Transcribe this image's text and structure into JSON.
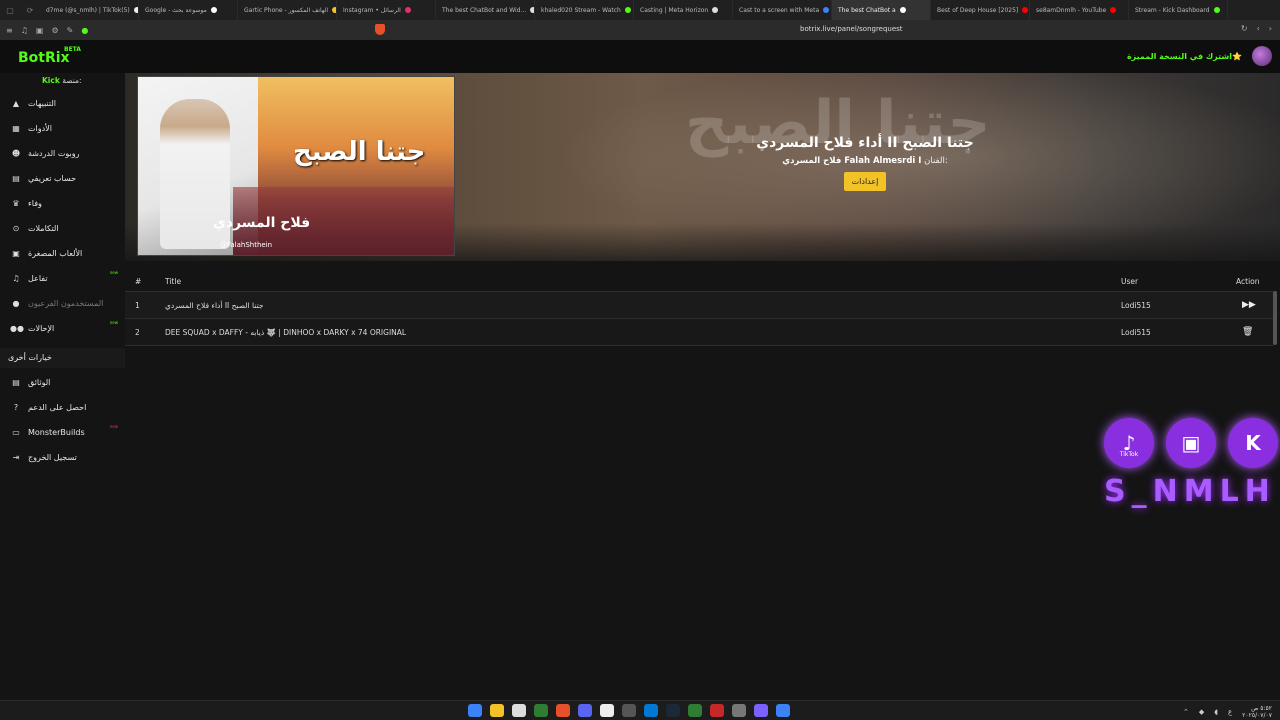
{
  "browser": {
    "tabs": [
      {
        "label": "d7me (@s_nmlh) | TikTok(5)",
        "color": "#eeeeee"
      },
      {
        "label": "Google - موسوعة بحث",
        "color": "#ffffff"
      },
      {
        "label": "Gartic Phone - الهاتف المكسور",
        "color": "#f2c226"
      },
      {
        "label": "Instagram • الرسائل",
        "color": "#e1306c"
      },
      {
        "label": "The best ChatBot and Wid...",
        "color": "#dddddd"
      },
      {
        "label": "khaled020 Stream - Watch",
        "color": "#53fc18"
      },
      {
        "label": "Casting | Meta Horizon",
        "color": "#dddddd"
      },
      {
        "label": "Cast to a screen with Meta",
        "color": "#3b82f6"
      },
      {
        "label": "The best ChatBot a",
        "color": "#ffffff",
        "active": true
      },
      {
        "label": "Best of Deep House [2025]",
        "color": "#ff0000"
      },
      {
        "label": "se8amDnmlh - YouTube",
        "color": "#ff0000"
      },
      {
        "label": "Stream - Kick Dashboard",
        "color": "#53fc18"
      }
    ],
    "url": "botrix.live/panel/songrequest"
  },
  "header": {
    "logo": "BotRix",
    "beta": "BETA",
    "premium_cta": "اشترك في النسخة المميزة⭐"
  },
  "sidebar": {
    "platform_label": "منصة:",
    "platform_value": "Kick",
    "items": [
      {
        "label": "التنبيهات",
        "icon": "warning-icon",
        "glyph": "▲"
      },
      {
        "label": "الأدوات",
        "icon": "grid-icon",
        "glyph": "▦"
      },
      {
        "label": "روبوت الدردشة",
        "icon": "robot-icon",
        "glyph": "☻"
      },
      {
        "label": "حساب تعريفي",
        "icon": "id-card-icon",
        "glyph": "▤"
      },
      {
        "label": "وفاء",
        "icon": "trophy-icon",
        "glyph": "♛"
      },
      {
        "label": "التكاملات",
        "icon": "link-icon",
        "glyph": "⊙"
      },
      {
        "label": "الألعاب المصغرة",
        "icon": "gamepad-icon",
        "glyph": "▣"
      },
      {
        "label": "تفاعل",
        "icon": "music-icon",
        "glyph": "♫",
        "tag": "new"
      },
      {
        "label": "المستخدمون الفرعيون",
        "icon": "users-icon",
        "glyph": "●",
        "dim": true
      },
      {
        "label": "الإحالات",
        "icon": "group-icon",
        "glyph": "●●",
        "tag": "new"
      }
    ],
    "section_title": "خيارات أخرى",
    "other_items": [
      {
        "label": "الوثائق",
        "icon": "docs-icon",
        "glyph": "▤"
      },
      {
        "label": "احصل على الدعم",
        "icon": "help-icon",
        "glyph": "?"
      },
      {
        "label": "MonsterBuilds",
        "icon": "monitor-icon",
        "glyph": "▭",
        "tag": "new"
      },
      {
        "label": "تسجيل الخروج",
        "icon": "logout-icon",
        "glyph": "⇥"
      }
    ]
  },
  "now_playing": {
    "title": "أداء فلاح المسردي II جتنا الصبح",
    "artist_label": "الفنان:",
    "artist": "فلاح المسردي Falah Almesrdi I",
    "settings_label": "إعدادات",
    "cover_title": "جتنا الصبح",
    "cover_handle": "@FalahShthein",
    "cover_sign": "فلاح المسردي"
  },
  "queue": {
    "columns": {
      "num": "#",
      "title": "Title",
      "user": "User",
      "action": "Action"
    },
    "rows": [
      {
        "num": "1",
        "title": "أداء فلاح المسردي II جتنا الصبح",
        "user": "Lodi515",
        "action_icon": "skip-icon",
        "glyph": "▶▶"
      },
      {
        "num": "2",
        "title": "DEE SQUAD x DAFFY - ذيابه 🐺 | DINHOO x DARKY x 74 ORIGINAL",
        "user": "Lodi515",
        "action_icon": "trash-icon",
        "glyph": "🗑"
      }
    ]
  },
  "overlay": {
    "socials": [
      {
        "name": "tiktok",
        "glyph": "♪",
        "sub": "TikTok"
      },
      {
        "name": "twitch",
        "glyph": "▣",
        "sub": ""
      },
      {
        "name": "kick",
        "glyph": "K",
        "sub": ""
      }
    ],
    "handle": "S_NMLH"
  },
  "taskbar": {
    "clock_time": "٥:٥٢ ص",
    "clock_date": "٢٠٢٥/٠٧/٠٧",
    "lang": "ع"
  },
  "colors": {
    "accent": "#53fc18",
    "settings_button": "#f2c226",
    "overlay_purple": "#8a2fe0"
  }
}
